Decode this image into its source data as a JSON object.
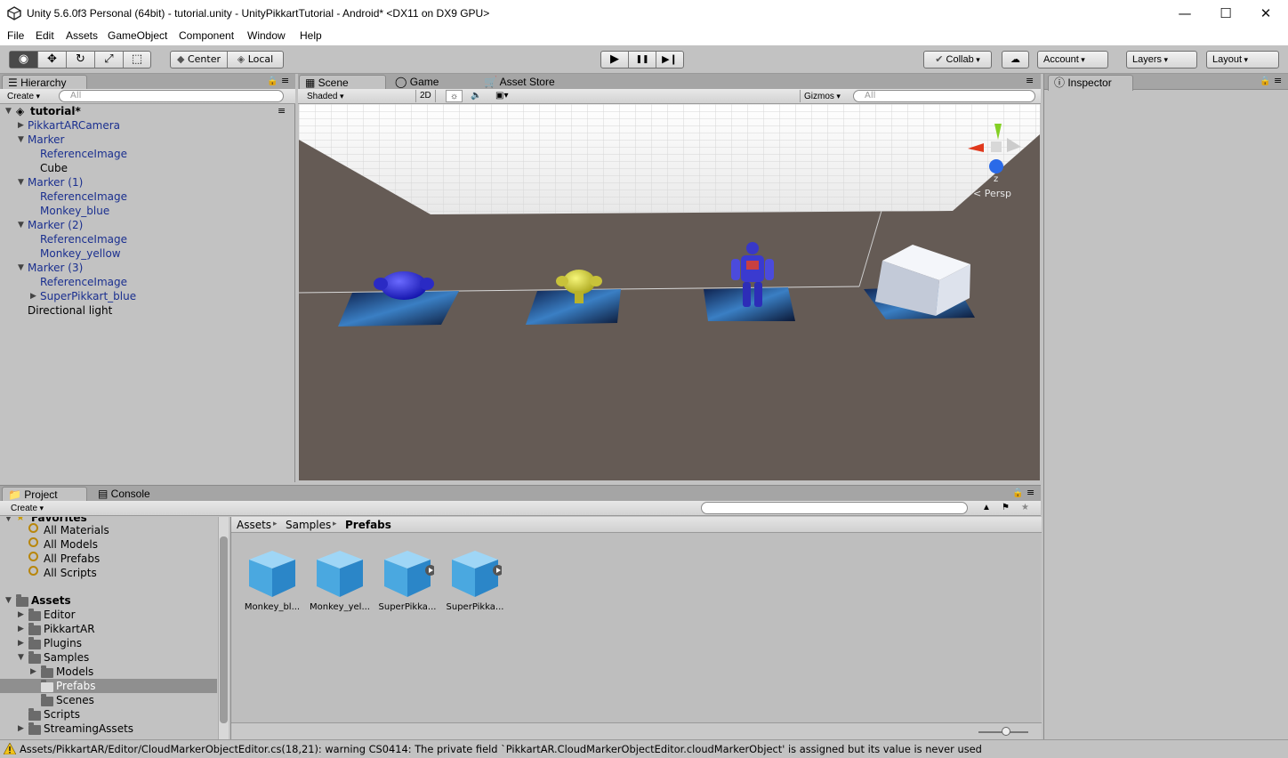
{
  "window": {
    "title": "Unity 5.6.0f3 Personal (64bit) - tutorial.unity - UnityPikkartTutorial - Android* <DX11 on DX9 GPU>",
    "minimize": "—",
    "maximize": "☐",
    "close": "✕"
  },
  "menu": [
    "File",
    "Edit",
    "Assets",
    "GameObject",
    "Component",
    "Window",
    "Help"
  ],
  "toolbar": {
    "tools": [
      "◉",
      "✥",
      "↻",
      "⤢",
      "⬚"
    ],
    "pivot": "Center",
    "space": "Local",
    "play": "▶",
    "pause": "❚❚",
    "step": "▶❙",
    "collab": "Collab",
    "cloud": "☁",
    "account": "Account",
    "layers": "Layers",
    "layout": "Layout"
  },
  "hierarchy": {
    "tab": "Hierarchy",
    "create": "Create",
    "search_placeholder": "All",
    "scene_name": "tutorial*",
    "items": [
      {
        "label": "PikkartARCamera"
      },
      {
        "label": "Marker"
      },
      {
        "label": "ReferenceImage"
      },
      {
        "label": "Cube"
      },
      {
        "label": "Marker (1)"
      },
      {
        "label": "ReferenceImage"
      },
      {
        "label": "Monkey_blue"
      },
      {
        "label": "Marker (2)"
      },
      {
        "label": "ReferenceImage"
      },
      {
        "label": "Monkey_yellow"
      },
      {
        "label": "Marker (3)"
      },
      {
        "label": "ReferenceImage"
      },
      {
        "label": "SuperPikkart_blue"
      },
      {
        "label": "Directional light"
      }
    ]
  },
  "scene_tabs": {
    "scene": "Scene",
    "game": "Game",
    "asset_store": "Asset Store",
    "shading": "Shaded",
    "mode2d": "2D",
    "gizmos": "Gizmos",
    "search_placeholder": "All",
    "persp": "Persp",
    "axis_z": "z"
  },
  "inspector": {
    "tab": "Inspector"
  },
  "project": {
    "tab": "Project",
    "console_tab": "Console",
    "create": "Create",
    "favorites_header": "Favorites",
    "favorites": [
      "All Materials",
      "All Models",
      "All Prefabs",
      "All Scripts"
    ],
    "assets_header": "Assets",
    "folders": [
      {
        "label": "Editor"
      },
      {
        "label": "PikkartAR"
      },
      {
        "label": "Plugins"
      },
      {
        "label": "Samples"
      },
      {
        "label": "Models"
      },
      {
        "label": "Prefabs"
      },
      {
        "label": "Scenes"
      },
      {
        "label": "Scripts"
      },
      {
        "label": "StreamingAssets"
      }
    ],
    "breadcrumb": [
      "Assets",
      "Samples",
      "Prefabs"
    ],
    "breadcrumb_sep": "▸",
    "assets": [
      {
        "label": "Monkey_bl..."
      },
      {
        "label": "Monkey_yel..."
      },
      {
        "label": "SuperPikka..."
      },
      {
        "label": "SuperPikka..."
      }
    ]
  },
  "status": {
    "message": "Assets/PikkartAR/Editor/CloudMarkerObjectEditor.cs(18,21): warning CS0414: The private field `PikkartAR.CloudMarkerObjectEditor.cloudMarkerObject' is assigned but its value is never used"
  }
}
